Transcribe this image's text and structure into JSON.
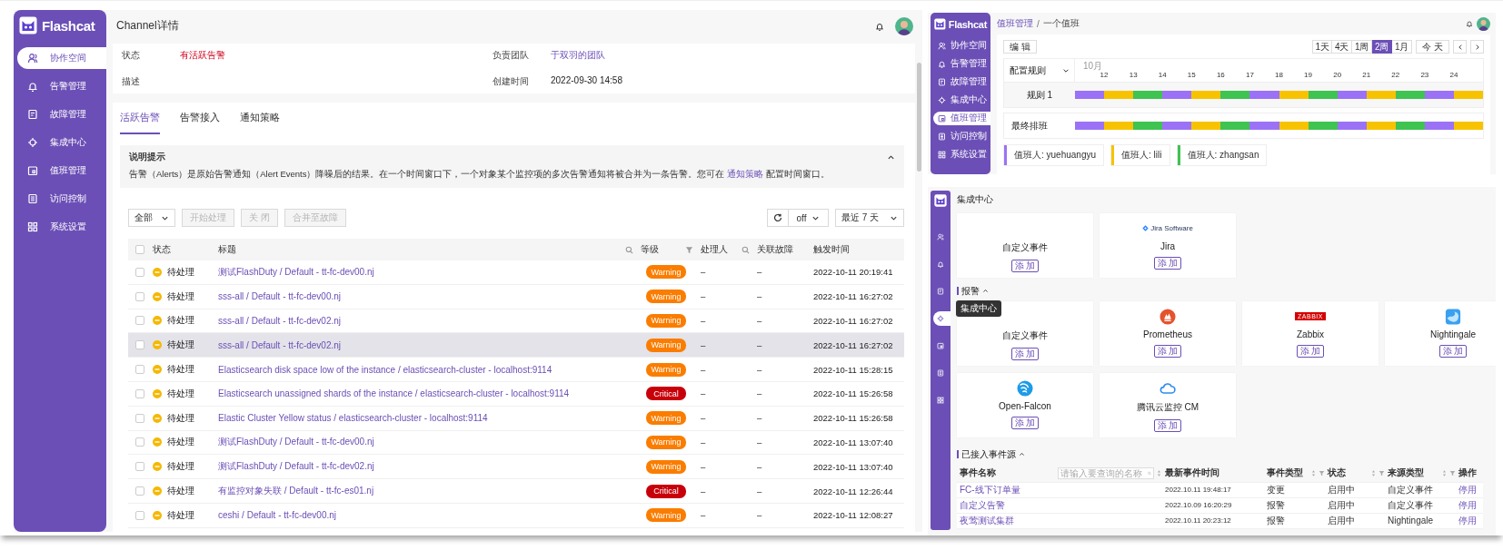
{
  "alert_page": {
    "sidebar": {
      "logo": "Flashcat",
      "items": [
        {
          "label": "协作空间",
          "selected": true
        },
        {
          "label": "告警管理",
          "selected": false
        },
        {
          "label": "故障管理",
          "selected": false
        },
        {
          "label": "集成中心",
          "selected": false
        },
        {
          "label": "值班管理",
          "selected": false
        },
        {
          "label": "访问控制",
          "selected": false
        },
        {
          "label": "系统设置",
          "selected": false
        }
      ]
    },
    "title": "Channel详情",
    "info": [
      {
        "label": "状态",
        "value": "有活跃告警",
        "kind": "status"
      },
      {
        "label": "负责团队",
        "value": "于双羽的团队",
        "kind": "link"
      },
      {
        "label": "描述"
      },
      {
        "label": "创建时间",
        "value": "2022-09-30 14:58",
        "kind": "plain"
      }
    ],
    "tabs": [
      {
        "label": "活跃告警",
        "selected": true
      },
      {
        "label": "告警接入",
        "selected": false
      },
      {
        "label": "通知策略",
        "selected": false
      }
    ],
    "notice": {
      "title": "说明提示",
      "expanded": true,
      "text_before": "告警（Alerts）是原始告警通知（Alert Events）降噪后的结果。在一个时间窗口下，一个对象某个监控项的多次告警通知将被合并为一条告警。您可在 ",
      "link": "通知策略",
      "text_after": " 配置时间窗口。"
    },
    "toolbar": {
      "filter": "全部",
      "buttons": [
        {
          "label": "开始处理",
          "disabled": true
        },
        {
          "label": "关 闭",
          "disabled": true
        },
        {
          "label": "合并至故障",
          "disabled": true
        }
      ],
      "refresh": "off",
      "range": "最近 7 天"
    },
    "table": {
      "all_checked": false,
      "columns": [
        "状态",
        "标题",
        "等级",
        "处理人",
        "关联故障",
        "触发时间"
      ],
      "rows": [
        {
          "checked": false,
          "hovered": false,
          "status": "待处理",
          "title": "测试FlashDuty / Default - tt-fc-dev00.nj",
          "level": "Warning",
          "kind": "warning",
          "assignee": "–",
          "incident": "–",
          "time": "2022-10-11 20:19:41"
        },
        {
          "checked": false,
          "hovered": false,
          "status": "待处理",
          "title": "sss-all / Default - tt-fc-dev00.nj",
          "level": "Warning",
          "kind": "warning",
          "assignee": "–",
          "incident": "–",
          "time": "2022-10-11 16:27:02"
        },
        {
          "checked": false,
          "hovered": false,
          "status": "待处理",
          "title": "sss-all / Default - tt-fc-dev02.nj",
          "level": "Warning",
          "kind": "warning",
          "assignee": "–",
          "incident": "–",
          "time": "2022-10-11 16:27:02"
        },
        {
          "checked": false,
          "hovered": true,
          "status": "待处理",
          "title": "sss-all / Default - tt-fc-dev02.nj",
          "level": "Warning",
          "kind": "warning",
          "assignee": "–",
          "incident": "–",
          "time": "2022-10-11 16:27:02"
        },
        {
          "checked": false,
          "hovered": false,
          "status": "待处理",
          "title": "Elasticsearch disk space low of the instance / elasticsearch-cluster - localhost:9114",
          "level": "Warning",
          "kind": "warning",
          "assignee": "–",
          "incident": "–",
          "time": "2022-10-11 15:28:15"
        },
        {
          "checked": false,
          "hovered": false,
          "status": "待处理",
          "title": "Elasticsearch unassigned shards of the instance / elasticsearch-cluster - localhost:9114",
          "level": "Critical",
          "kind": "critical",
          "assignee": "–",
          "incident": "–",
          "time": "2022-10-11 15:26:58"
        },
        {
          "checked": false,
          "hovered": false,
          "status": "待处理",
          "title": "Elastic Cluster Yellow status / elasticsearch-cluster - localhost:9114",
          "level": "Warning",
          "kind": "warning",
          "assignee": "–",
          "incident": "–",
          "time": "2022-10-11 15:26:58"
        },
        {
          "checked": false,
          "hovered": false,
          "status": "待处理",
          "title": "测试FlashDuty / Default - tt-fc-dev00.nj",
          "level": "Warning",
          "kind": "warning",
          "assignee": "–",
          "incident": "–",
          "time": "2022-10-11 13:07:40"
        },
        {
          "checked": false,
          "hovered": false,
          "status": "待处理",
          "title": "测试FlashDuty / Default - tt-fc-dev02.nj",
          "level": "Warning",
          "kind": "warning",
          "assignee": "–",
          "incident": "–",
          "time": "2022-10-11 13:07:40"
        },
        {
          "checked": false,
          "hovered": false,
          "status": "待处理",
          "title": "有监控对象失联 / Default - tt-fc-es01.nj",
          "level": "Critical",
          "kind": "critical",
          "assignee": "–",
          "incident": "–",
          "time": "2022-10-11 12:26:44"
        },
        {
          "checked": false,
          "hovered": false,
          "status": "待处理",
          "title": "ceshi / Default - tt-fc-dev00.nj",
          "level": "Warning",
          "kind": "warning",
          "assignee": "–",
          "incident": "–",
          "time": "2022-10-11 12:08:27"
        }
      ]
    }
  },
  "schedule_page": {
    "sidebar": {
      "logo": "Flashcat",
      "items": [
        {
          "label": "协作空间",
          "selected": false
        },
        {
          "label": "告警管理",
          "selected": false
        },
        {
          "label": "故障管理",
          "selected": false
        },
        {
          "label": "集成中心",
          "selected": false
        },
        {
          "label": "值班管理",
          "selected": true
        },
        {
          "label": "访问控制",
          "selected": false
        },
        {
          "label": "系统设置",
          "selected": false
        }
      ]
    },
    "breadcrumb": [
      {
        "label": "值班管理",
        "kind": "link"
      },
      {
        "label": "一个值班",
        "kind": "current"
      }
    ],
    "separator": "/",
    "edit_button": "编 辑",
    "ranges": [
      {
        "label": "1天",
        "selected": false
      },
      {
        "label": "4天",
        "selected": false
      },
      {
        "label": "1周",
        "selected": false
      },
      {
        "label": "2周",
        "selected": true
      },
      {
        "label": "1月",
        "selected": false
      }
    ],
    "today_button": "今 天",
    "timeline": {
      "rule_header": "配置规则",
      "month": "10月",
      "days": [
        "12",
        "13",
        "14",
        "15",
        "16",
        "17",
        "18",
        "19",
        "20",
        "21",
        "22",
        "23",
        "24"
      ],
      "rows": [
        {
          "label": "规则 1",
          "kind": "rule",
          "segments": [
            {
              "color": "#9b72f6"
            },
            {
              "color": "#f7c300"
            },
            {
              "color": "#3fc351"
            },
            {
              "color": "#9b72f6"
            },
            {
              "color": "#f7c300"
            },
            {
              "color": "#3fc351"
            },
            {
              "color": "#9b72f6"
            },
            {
              "color": "#f7c300"
            },
            {
              "color": "#3fc351"
            },
            {
              "color": "#9b72f6"
            },
            {
              "color": "#f7c300"
            },
            {
              "color": "#3fc351"
            },
            {
              "color": "#9b72f6"
            },
            {
              "color": "#f7c300"
            }
          ]
        },
        {
          "label": "最终排班",
          "kind": "final",
          "segments": [
            {
              "color": "#9b72f6"
            },
            {
              "color": "#f7c300"
            },
            {
              "color": "#3fc351"
            },
            {
              "color": "#9b72f6"
            },
            {
              "color": "#f7c300"
            },
            {
              "color": "#3fc351"
            },
            {
              "color": "#9b72f6"
            },
            {
              "color": "#f7c300"
            },
            {
              "color": "#3fc351"
            },
            {
              "color": "#9b72f6"
            },
            {
              "color": "#f7c300"
            },
            {
              "color": "#3fc351"
            },
            {
              "color": "#9b72f6"
            },
            {
              "color": "#f7c300"
            }
          ]
        }
      ]
    },
    "legend": [
      {
        "label": "值班人: yuehuangyu",
        "color": "#9b72f6"
      },
      {
        "label": "值班人: lili",
        "color": "#f7c300"
      },
      {
        "label": "值班人: zhangsan",
        "color": "#3fc351"
      }
    ]
  },
  "integration_page": {
    "sidebar": {
      "items": [
        {
          "selected": false
        },
        {
          "selected": false
        },
        {
          "selected": false
        },
        {
          "selected": true
        },
        {
          "selected": false
        },
        {
          "selected": false
        },
        {
          "selected": false
        }
      ]
    },
    "tooltip": "集成中心",
    "title": "集成中心",
    "groups": [
      {
        "cards": [
          {
            "name": "自定义事件",
            "kind": "plain",
            "button": "添 加"
          },
          {
            "name": "Jira",
            "kind": "jira",
            "logo_text": "Jira Software",
            "button": "添 加"
          }
        ]
      },
      {
        "heading": "报警",
        "expanded": true,
        "cards": [
          {
            "name": "自定义事件",
            "kind": "plain",
            "button": "添 加"
          },
          {
            "name": "Prometheus",
            "kind": "prometheus",
            "button": "添 加"
          },
          {
            "name": "Zabbix",
            "kind": "zabbix",
            "logo_text": "ZABBIX",
            "button": "添 加"
          },
          {
            "name": "Nightingale",
            "kind": "nightingale",
            "button": "添 加"
          },
          {
            "name": "Open-Falcon",
            "kind": "openfalcon",
            "button": "添 加"
          },
          {
            "name": "腾讯云监控 CM",
            "kind": "tencent",
            "button": "添 加"
          }
        ]
      }
    ],
    "event_sources": {
      "heading": "已接入事件源",
      "expanded": true,
      "search_placeholder": "请输入要查询的名称",
      "columns": [
        "事件名称",
        "最新事件时间",
        "事件类型",
        "状态",
        "来源类型",
        "操作"
      ],
      "rows": [
        {
          "name": "FC-线下订单量",
          "time": "2022.10.11 19:48:17",
          "type": "变更",
          "status": "启用中",
          "source": "自定义事件",
          "action": "停用"
        },
        {
          "name": "自定义告警",
          "time": "2022.10.09 16:20:29",
          "type": "报警",
          "status": "启用中",
          "source": "自定义事件",
          "action": "停用"
        },
        {
          "name": "夜莺测试集群",
          "time": "2022.10.11 20:23:12",
          "type": "报警",
          "status": "启用中",
          "source": "Nightingale",
          "action": "停用"
        }
      ]
    }
  }
}
